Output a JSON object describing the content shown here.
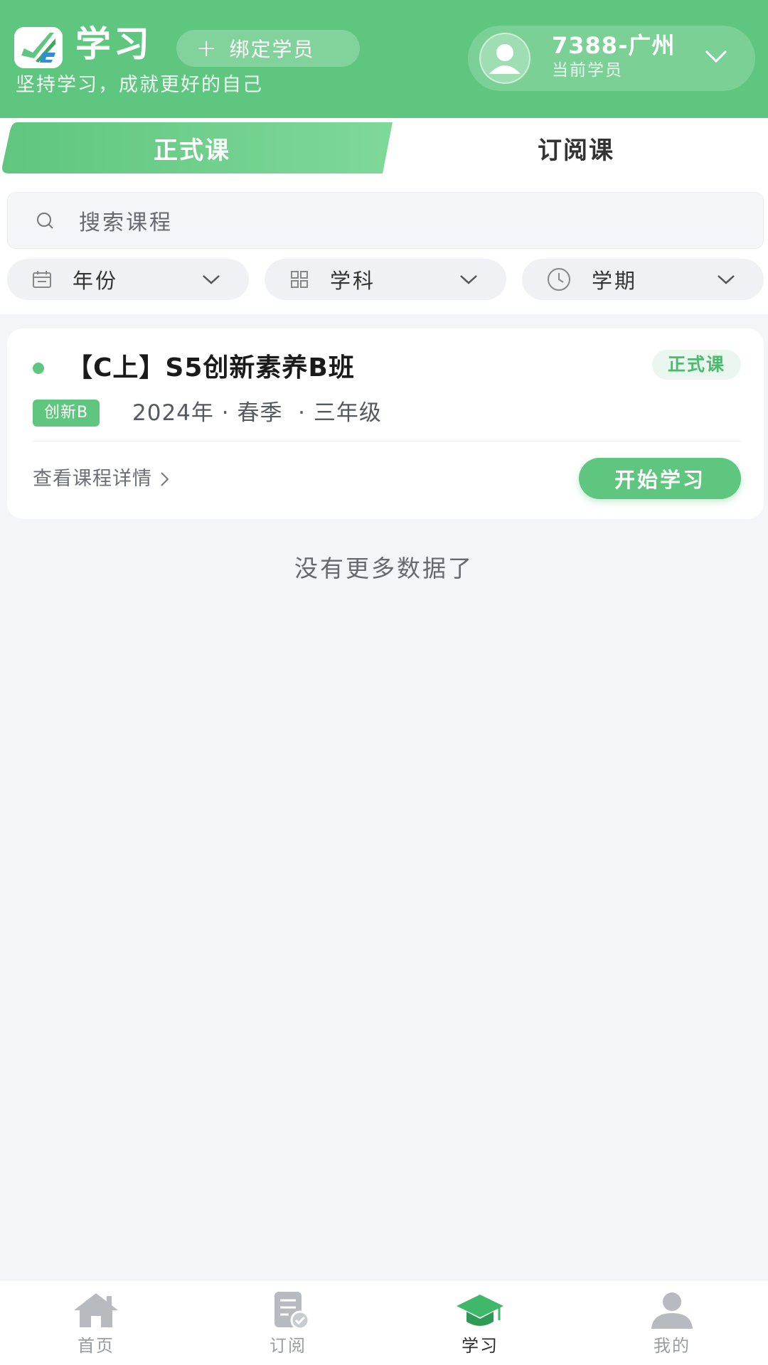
{
  "header": {
    "title": "学习",
    "bind_button": "绑定学员",
    "subtitle": "坚持学习，成就更好的自己",
    "student_name": "7388-广州",
    "student_role": "当前学员"
  },
  "tabs": [
    {
      "label": "正式课",
      "active": true
    },
    {
      "label": "订阅课",
      "active": false
    }
  ],
  "search": {
    "placeholder": "搜索课程"
  },
  "filters": [
    {
      "label": "年份",
      "icon": "calendar-icon"
    },
    {
      "label": "学科",
      "icon": "grid-icon"
    },
    {
      "label": "学期",
      "icon": "clock-icon"
    }
  ],
  "courses": [
    {
      "title": "【C上】S5创新素养B班",
      "badge": "正式课",
      "tag": "创新B",
      "meta": "2024年 · 春季  · 三年级",
      "detail_link": "查看课程详情",
      "start_button": "开始学习"
    }
  ],
  "list_end": "没有更多数据了",
  "bottom_nav": [
    {
      "label": "首页",
      "icon": "home-icon",
      "active": false
    },
    {
      "label": "订阅",
      "icon": "subscription-icon",
      "active": false
    },
    {
      "label": "学习",
      "icon": "graduation-cap-icon",
      "active": true
    },
    {
      "label": "我的",
      "icon": "profile-icon",
      "active": false
    }
  ],
  "colors": {
    "brand_green": "#5fc67f",
    "background": "#f4f5f8"
  }
}
